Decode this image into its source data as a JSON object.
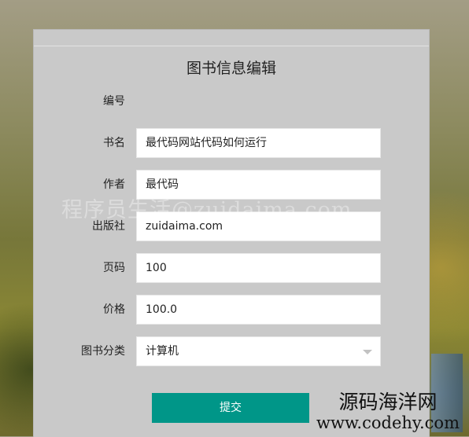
{
  "form": {
    "title": "图书信息编辑",
    "fields": [
      {
        "label": "编号",
        "value": ""
      },
      {
        "label": "书名",
        "value": "最代码网站代码如何运行"
      },
      {
        "label": "作者",
        "value": "最代码"
      },
      {
        "label": "出版社",
        "value": "zuidaima.com"
      },
      {
        "label": "页码",
        "value": "100"
      },
      {
        "label": "价格",
        "value": "100.0"
      },
      {
        "label": "图书分类",
        "value": "计算机"
      }
    ],
    "submit_label": "提交"
  },
  "watermark": "程序员生活@zuidaima.com",
  "brand": {
    "name": "源码海洋网",
    "url": "www.codehy.com"
  },
  "colors": {
    "submit_bg": "#009688",
    "panel_bg": "#c9c9c9"
  }
}
